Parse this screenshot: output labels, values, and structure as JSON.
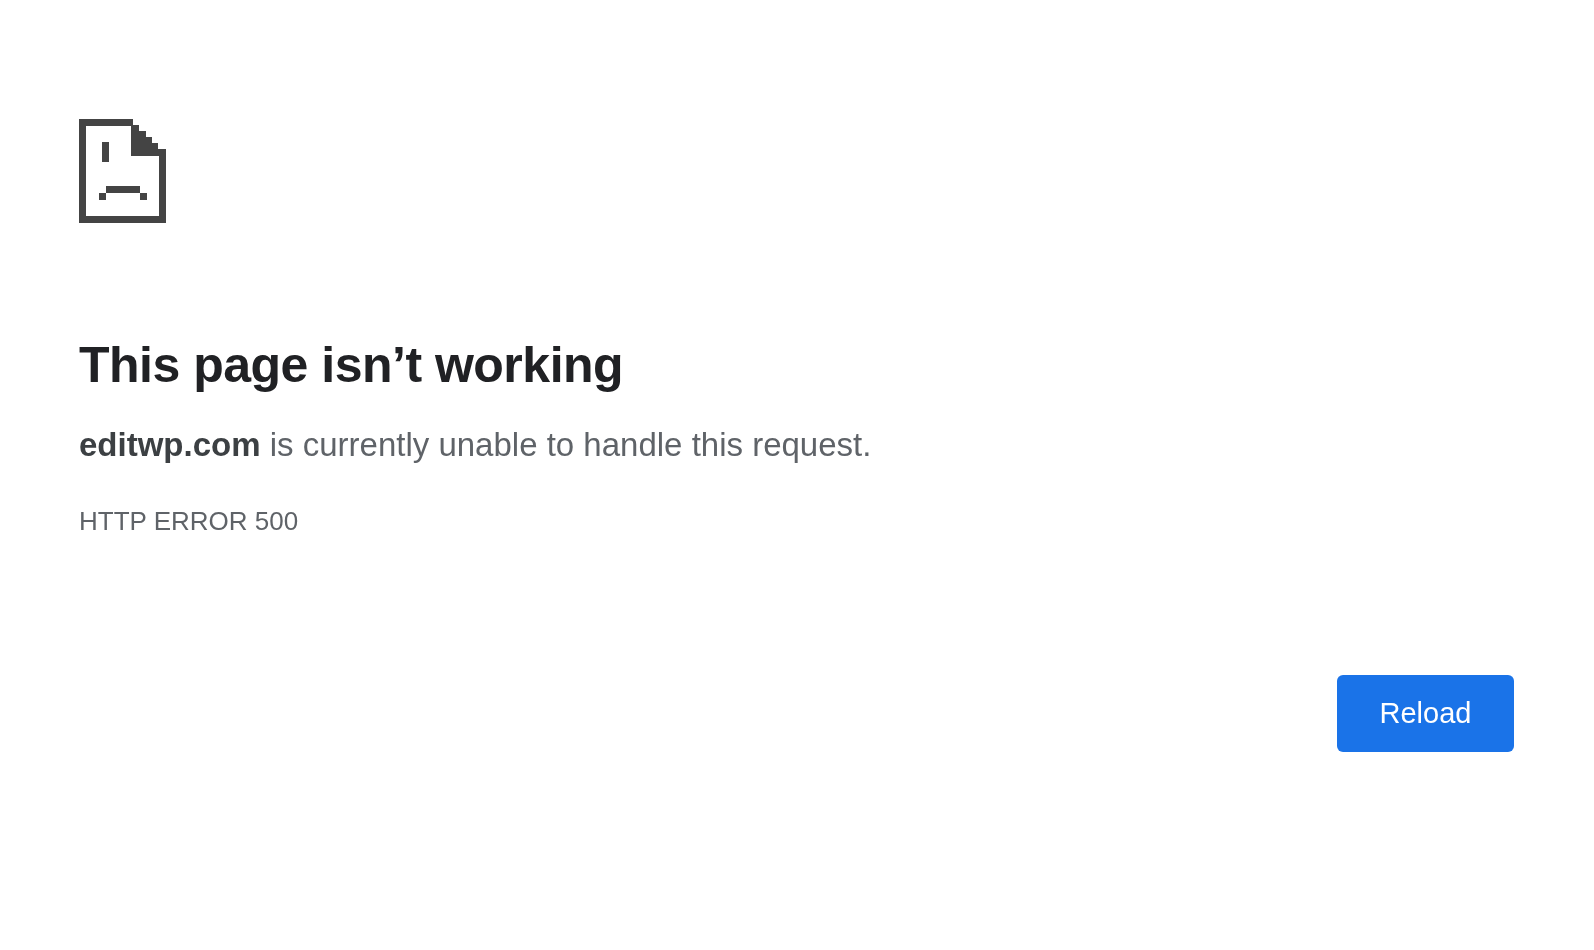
{
  "heading": "This page isn’t working",
  "message": "**editwp.com** is currently unable to handle this request.",
  "error_code": "HTTP ERROR 500",
  "buttons": [
    {
      "label": "Reload"
    }
  ]
}
